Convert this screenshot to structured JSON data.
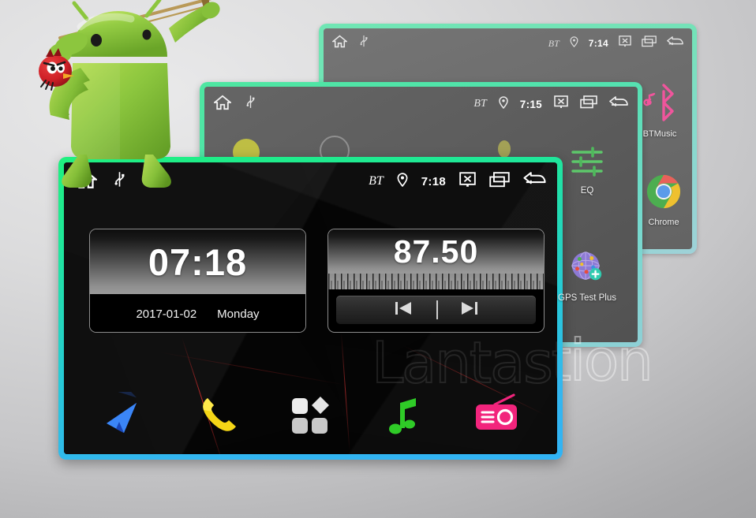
{
  "page": {
    "watermark": "Lantastion",
    "background_color": "#c8c8ca"
  },
  "mascot": {
    "name": "android-robot-violin",
    "body_color": "#8cc63e",
    "bird_color": "#cf2027",
    "description": "Android robot playing a violin with a red bird perched on the bow"
  },
  "screens": [
    {
      "id": "back",
      "border_color": "#74e2b8",
      "background_color": "#6f6f6f",
      "statusbar": {
        "home_label": "Home",
        "usb_label": "USB",
        "bt_label": "BT",
        "gps_label": "GPS",
        "time": "7:14",
        "screenoff_label": "Screen Off",
        "recents_label": "Recent Apps",
        "back_label": "Back"
      }
    },
    {
      "id": "middle",
      "border_color": "#52e2ae",
      "background_color": "#5d5d5d",
      "statusbar": {
        "home_label": "Home",
        "usb_label": "USB",
        "bt_label": "BT",
        "gps_label": "GPS",
        "time": "7:15",
        "screenoff_label": "Screen Off",
        "recents_label": "Recent Apps",
        "back_label": "Back"
      }
    },
    {
      "id": "front",
      "border_color_top": "#1ff07f",
      "border_color_bottom": "#31b3f5",
      "background_color": "#040404",
      "statusbar": {
        "home_label": "Home",
        "usb_label": "USB",
        "bt_label": "BT",
        "gps_label": "GPS",
        "time": "7:18",
        "screenoff_label": "Screen Off",
        "recents_label": "Recent Apps",
        "back_label": "Back"
      }
    }
  ],
  "clock_widget": {
    "time": "07:18",
    "date": "2017-01-02",
    "weekday": "Monday"
  },
  "radio_widget": {
    "frequency": "87.50",
    "prev_label": "Previous Station",
    "next_label": "Next Station"
  },
  "dock": [
    {
      "name": "navigation-icon",
      "label": "Navigation",
      "color": "#2f6df0"
    },
    {
      "name": "phone-icon",
      "label": "Phone",
      "color": "#f5d616"
    },
    {
      "name": "apps-grid-icon",
      "label": "Apps",
      "color": "#e8e8e8"
    },
    {
      "name": "music-icon",
      "label": "Music",
      "color": "#2fcb27"
    },
    {
      "name": "radio-icon",
      "label": "Radio",
      "color": "#f2247c"
    }
  ],
  "side_apps": [
    {
      "name": "eq-icon",
      "label": "EQ",
      "color": "#5dc76a"
    },
    {
      "name": "gps-test-plus-icon",
      "label": "GPS Test Plus",
      "color": "#8d7ad4"
    },
    {
      "name": "bt-music-icon",
      "label": "BTMusic",
      "color": "#f0559c"
    },
    {
      "name": "chrome-icon",
      "label": "Chrome",
      "color": "#4285f4"
    }
  ]
}
